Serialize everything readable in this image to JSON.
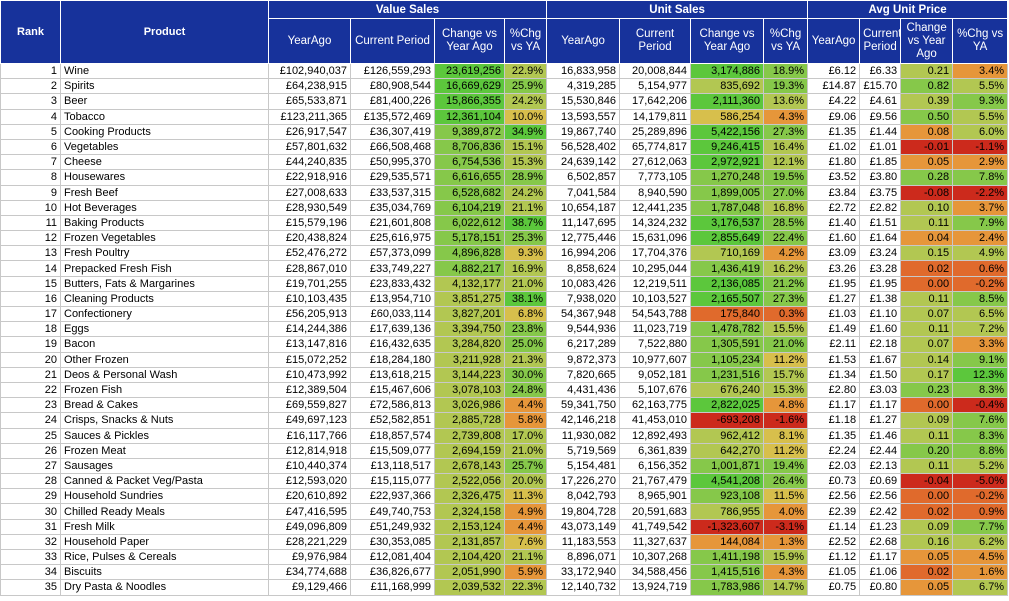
{
  "headers": {
    "rank": "Rank",
    "product": "Product",
    "groups": [
      "Value Sales",
      "Unit Sales",
      "Avg Unit Price"
    ],
    "sub": [
      "YearAgo",
      "Current Period",
      "Change vs Year Ago",
      "%Chg vs YA",
      "YearAgo",
      "Current Period",
      "Change vs Year Ago",
      "%Chg vs YA",
      "YearAgo",
      "Current Period",
      "Change vs Year Ago",
      "%Chg vs YA"
    ]
  },
  "colors": {
    "header": "#17329b",
    "strong_green": "#5cc73c",
    "green": "#86c84a",
    "yellow_green": "#b2c752",
    "yellow": "#d7bf4c",
    "orange": "#e6963a",
    "orange_red": "#e06a2c",
    "red": "#cc2a1c"
  },
  "rows": [
    [
      "1",
      "Wine",
      "£102,940,037",
      "£126,559,293",
      "23,619,256",
      "22.9%",
      "16,833,958",
      "20,008,844",
      "3,174,886",
      "18.9%",
      "£6.12",
      "£6.33",
      "0.21",
      "3.4%"
    ],
    [
      "2",
      "Spirits",
      "£64,238,915",
      "£80,908,544",
      "16,669,629",
      "25.9%",
      "4,319,285",
      "5,154,977",
      "835,692",
      "19.3%",
      "£14.87",
      "£15.70",
      "0.82",
      "5.5%"
    ],
    [
      "3",
      "Beer",
      "£65,533,871",
      "£81,400,226",
      "15,866,355",
      "24.2%",
      "15,530,846",
      "17,642,206",
      "2,111,360",
      "13.6%",
      "£4.22",
      "£4.61",
      "0.39",
      "9.3%"
    ],
    [
      "4",
      "Tobacco",
      "£123,211,365",
      "£135,572,469",
      "12,361,104",
      "10.0%",
      "13,593,557",
      "14,179,811",
      "586,254",
      "4.3%",
      "£9.06",
      "£9.56",
      "0.50",
      "5.5%"
    ],
    [
      "5",
      "Cooking Products",
      "£26,917,547",
      "£36,307,419",
      "9,389,872",
      "34.9%",
      "19,867,740",
      "25,289,896",
      "5,422,156",
      "27.3%",
      "£1.35",
      "£1.44",
      "0.08",
      "6.0%"
    ],
    [
      "6",
      "Vegetables",
      "£57,801,632",
      "£66,508,468",
      "8,706,836",
      "15.1%",
      "56,528,402",
      "65,774,817",
      "9,246,415",
      "16.4%",
      "£1.02",
      "£1.01",
      "-0.01",
      "-1.1%"
    ],
    [
      "7",
      "Cheese",
      "£44,240,835",
      "£50,995,370",
      "6,754,536",
      "15.3%",
      "24,639,142",
      "27,612,063",
      "2,972,921",
      "12.1%",
      "£1.80",
      "£1.85",
      "0.05",
      "2.9%"
    ],
    [
      "8",
      "Housewares",
      "£22,918,916",
      "£29,535,571",
      "6,616,655",
      "28.9%",
      "6,502,857",
      "7,773,105",
      "1,270,248",
      "19.5%",
      "£3.52",
      "£3.80",
      "0.28",
      "7.8%"
    ],
    [
      "9",
      "Fresh Beef",
      "£27,008,633",
      "£33,537,315",
      "6,528,682",
      "24.2%",
      "7,041,584",
      "8,940,590",
      "1,899,005",
      "27.0%",
      "£3.84",
      "£3.75",
      "-0.08",
      "-2.2%"
    ],
    [
      "10",
      "Hot Beverages",
      "£28,930,549",
      "£35,034,769",
      "6,104,219",
      "21.1%",
      "10,654,187",
      "12,441,235",
      "1,787,048",
      "16.8%",
      "£2.72",
      "£2.82",
      "0.10",
      "3.7%"
    ],
    [
      "11",
      "Baking Products",
      "£15,579,196",
      "£21,601,808",
      "6,022,612",
      "38.7%",
      "11,147,695",
      "14,324,232",
      "3,176,537",
      "28.5%",
      "£1.40",
      "£1.51",
      "0.11",
      "7.9%"
    ],
    [
      "12",
      "Frozen Vegetables",
      "£20,438,824",
      "£25,616,975",
      "5,178,151",
      "25.3%",
      "12,775,446",
      "15,631,096",
      "2,855,649",
      "22.4%",
      "£1.60",
      "£1.64",
      "0.04",
      "2.4%"
    ],
    [
      "13",
      "Fresh Poultry",
      "£52,476,272",
      "£57,373,099",
      "4,896,828",
      "9.3%",
      "16,994,206",
      "17,704,376",
      "710,169",
      "4.2%",
      "£3.09",
      "£3.24",
      "0.15",
      "4.9%"
    ],
    [
      "14",
      "Prepacked Fresh Fish",
      "£28,867,010",
      "£33,749,227",
      "4,882,217",
      "16.9%",
      "8,858,624",
      "10,295,044",
      "1,436,419",
      "16.2%",
      "£3.26",
      "£3.28",
      "0.02",
      "0.6%"
    ],
    [
      "15",
      "Butters, Fats & Margarines",
      "£19,701,255",
      "£23,833,432",
      "4,132,177",
      "21.0%",
      "10,083,426",
      "12,219,511",
      "2,136,085",
      "21.2%",
      "£1.95",
      "£1.95",
      "0.00",
      "-0.2%"
    ],
    [
      "16",
      "Cleaning Products",
      "£10,103,435",
      "£13,954,710",
      "3,851,275",
      "38.1%",
      "7,938,020",
      "10,103,527",
      "2,165,507",
      "27.3%",
      "£1.27",
      "£1.38",
      "0.11",
      "8.5%"
    ],
    [
      "17",
      "Confectionery",
      "£56,205,913",
      "£60,033,114",
      "3,827,201",
      "6.8%",
      "54,367,948",
      "54,543,788",
      "175,840",
      "0.3%",
      "£1.03",
      "£1.10",
      "0.07",
      "6.5%"
    ],
    [
      "18",
      "Eggs",
      "£14,244,386",
      "£17,639,136",
      "3,394,750",
      "23.8%",
      "9,544,936",
      "11,023,719",
      "1,478,782",
      "15.5%",
      "£1.49",
      "£1.60",
      "0.11",
      "7.2%"
    ],
    [
      "19",
      "Bacon",
      "£13,147,816",
      "£16,432,635",
      "3,284,820",
      "25.0%",
      "6,217,289",
      "7,522,880",
      "1,305,591",
      "21.0%",
      "£2.11",
      "£2.18",
      "0.07",
      "3.3%"
    ],
    [
      "20",
      "Other Frozen",
      "£15,072,252",
      "£18,284,180",
      "3,211,928",
      "21.3%",
      "9,872,373",
      "10,977,607",
      "1,105,234",
      "11.2%",
      "£1.53",
      "£1.67",
      "0.14",
      "9.1%"
    ],
    [
      "21",
      "Deos & Personal Wash",
      "£10,473,992",
      "£13,618,215",
      "3,144,223",
      "30.0%",
      "7,820,665",
      "9,052,181",
      "1,231,516",
      "15.7%",
      "£1.34",
      "£1.50",
      "0.17",
      "12.3%"
    ],
    [
      "22",
      "Frozen Fish",
      "£12,389,504",
      "£15,467,606",
      "3,078,103",
      "24.8%",
      "4,431,436",
      "5,107,676",
      "676,240",
      "15.3%",
      "£2.80",
      "£3.03",
      "0.23",
      "8.3%"
    ],
    [
      "23",
      "Bread & Cakes",
      "£69,559,827",
      "£72,586,813",
      "3,026,986",
      "4.4%",
      "59,341,750",
      "62,163,775",
      "2,822,025",
      "4.8%",
      "£1.17",
      "£1.17",
      "0.00",
      "-0.4%"
    ],
    [
      "24",
      "Crisps, Snacks & Nuts",
      "£49,697,123",
      "£52,582,851",
      "2,885,728",
      "5.8%",
      "42,146,218",
      "41,453,010",
      "-693,208",
      "-1.6%",
      "£1.18",
      "£1.27",
      "0.09",
      "7.6%"
    ],
    [
      "25",
      "Sauces & Pickles",
      "£16,117,766",
      "£18,857,574",
      "2,739,808",
      "17.0%",
      "11,930,082",
      "12,892,493",
      "962,412",
      "8.1%",
      "£1.35",
      "£1.46",
      "0.11",
      "8.3%"
    ],
    [
      "26",
      "Frozen Meat",
      "£12,814,918",
      "£15,509,077",
      "2,694,159",
      "21.0%",
      "5,719,569",
      "6,361,839",
      "642,270",
      "11.2%",
      "£2.24",
      "£2.44",
      "0.20",
      "8.8%"
    ],
    [
      "27",
      "Sausages",
      "£10,440,374",
      "£13,118,517",
      "2,678,143",
      "25.7%",
      "5,154,481",
      "6,156,352",
      "1,001,871",
      "19.4%",
      "£2.03",
      "£2.13",
      "0.11",
      "5.2%"
    ],
    [
      "28",
      "Canned & Packet Veg/Pasta",
      "£12,593,020",
      "£15,115,077",
      "2,522,056",
      "20.0%",
      "17,226,270",
      "21,767,479",
      "4,541,208",
      "26.4%",
      "£0.73",
      "£0.69",
      "-0.04",
      "-5.0%"
    ],
    [
      "29",
      "Household Sundries",
      "£20,610,892",
      "£22,937,366",
      "2,326,475",
      "11.3%",
      "8,042,793",
      "8,965,901",
      "923,108",
      "11.5%",
      "£2.56",
      "£2.56",
      "0.00",
      "-0.2%"
    ],
    [
      "30",
      "Chilled Ready Meals",
      "£47,416,595",
      "£49,740,753",
      "2,324,158",
      "4.9%",
      "19,804,728",
      "20,591,683",
      "786,955",
      "4.0%",
      "£2.39",
      "£2.42",
      "0.02",
      "0.9%"
    ],
    [
      "31",
      "Fresh Milk",
      "£49,096,809",
      "£51,249,932",
      "2,153,124",
      "4.4%",
      "43,073,149",
      "41,749,542",
      "-1,323,607",
      "-3.1%",
      "£1.14",
      "£1.23",
      "0.09",
      "7.7%"
    ],
    [
      "32",
      "Household Paper",
      "£28,221,229",
      "£30,353,085",
      "2,131,857",
      "7.6%",
      "11,183,553",
      "11,327,637",
      "144,084",
      "1.3%",
      "£2.52",
      "£2.68",
      "0.16",
      "6.2%"
    ],
    [
      "33",
      "Rice, Pulses & Cereals",
      "£9,976,984",
      "£12,081,404",
      "2,104,420",
      "21.1%",
      "8,896,071",
      "10,307,268",
      "1,411,198",
      "15.9%",
      "£1.12",
      "£1.17",
      "0.05",
      "4.5%"
    ],
    [
      "34",
      "Biscuits",
      "£34,774,688",
      "£36,826,677",
      "2,051,990",
      "5.9%",
      "33,172,940",
      "34,588,456",
      "1,415,516",
      "4.3%",
      "£1.05",
      "£1.06",
      "0.02",
      "1.6%"
    ],
    [
      "35",
      "Dry Pasta & Noodles",
      "£9,129,466",
      "£11,168,999",
      "2,039,532",
      "22.3%",
      "12,140,732",
      "13,924,719",
      "1,783,986",
      "14.7%",
      "£0.75",
      "£0.80",
      "0.05",
      "6.7%"
    ]
  ],
  "cell_colors": [
    [
      "strong_green",
      "yellow_green",
      "strong_green",
      "green",
      "yellow_green",
      "orange"
    ],
    [
      "strong_green",
      "green",
      "yellow_green",
      "green",
      "green",
      "yellow_green"
    ],
    [
      "strong_green",
      "yellow_green",
      "strong_green",
      "yellow_green",
      "yellow_green",
      "green"
    ],
    [
      "strong_green",
      "yellow",
      "yellow",
      "orange",
      "green",
      "yellow_green"
    ],
    [
      "green",
      "strong_green",
      "strong_green",
      "green",
      "orange",
      "yellow_green"
    ],
    [
      "green",
      "yellow_green",
      "strong_green",
      "yellow_green",
      "red",
      "red"
    ],
    [
      "green",
      "yellow_green",
      "strong_green",
      "yellow_green",
      "orange",
      "orange"
    ],
    [
      "green",
      "green",
      "green",
      "green",
      "green",
      "green"
    ],
    [
      "green",
      "yellow_green",
      "green",
      "green",
      "red",
      "red"
    ],
    [
      "green",
      "yellow_green",
      "green",
      "yellow_green",
      "yellow_green",
      "orange"
    ],
    [
      "green",
      "strong_green",
      "strong_green",
      "green",
      "yellow_green",
      "green"
    ],
    [
      "green",
      "green",
      "strong_green",
      "green",
      "orange",
      "orange"
    ],
    [
      "green",
      "yellow",
      "yellow_green",
      "orange",
      "yellow_green",
      "yellow_green"
    ],
    [
      "green",
      "yellow_green",
      "green",
      "yellow_green",
      "orange_red",
      "orange_red"
    ],
    [
      "yellow_green",
      "yellow_green",
      "strong_green",
      "green",
      "orange_red",
      "orange_red"
    ],
    [
      "yellow_green",
      "strong_green",
      "strong_green",
      "green",
      "yellow_green",
      "green"
    ],
    [
      "yellow_green",
      "yellow",
      "orange_red",
      "orange_red",
      "yellow_green",
      "yellow_green"
    ],
    [
      "yellow_green",
      "green",
      "green",
      "yellow_green",
      "yellow_green",
      "yellow_green"
    ],
    [
      "yellow_green",
      "green",
      "green",
      "green",
      "yellow_green",
      "orange"
    ],
    [
      "yellow_green",
      "yellow_green",
      "green",
      "yellow",
      "yellow_green",
      "green"
    ],
    [
      "yellow_green",
      "green",
      "green",
      "yellow_green",
      "yellow_green",
      "strong_green"
    ],
    [
      "yellow_green",
      "green",
      "yellow_green",
      "yellow_green",
      "green",
      "green"
    ],
    [
      "yellow_green",
      "orange",
      "strong_green",
      "orange",
      "orange_red",
      "red"
    ],
    [
      "yellow_green",
      "orange",
      "red",
      "red",
      "yellow_green",
      "green"
    ],
    [
      "yellow_green",
      "yellow_green",
      "yellow_green",
      "yellow",
      "yellow_green",
      "green"
    ],
    [
      "yellow_green",
      "yellow_green",
      "yellow_green",
      "yellow",
      "green",
      "green"
    ],
    [
      "yellow_green",
      "green",
      "green",
      "green",
      "yellow_green",
      "yellow_green"
    ],
    [
      "yellow_green",
      "yellow_green",
      "strong_green",
      "green",
      "red",
      "red"
    ],
    [
      "yellow_green",
      "yellow",
      "green",
      "yellow",
      "orange_red",
      "orange_red"
    ],
    [
      "yellow_green",
      "orange",
      "yellow_green",
      "orange",
      "orange_red",
      "orange_red"
    ],
    [
      "yellow_green",
      "orange",
      "red",
      "red",
      "yellow_green",
      "green"
    ],
    [
      "yellow_green",
      "yellow",
      "orange",
      "orange",
      "yellow_green",
      "yellow_green"
    ],
    [
      "yellow_green",
      "yellow_green",
      "green",
      "yellow_green",
      "orange",
      "orange"
    ],
    [
      "yellow_green",
      "orange",
      "green",
      "orange",
      "orange_red",
      "orange"
    ],
    [
      "yellow_green",
      "yellow_green",
      "green",
      "yellow_green",
      "orange",
      "yellow_green"
    ]
  ]
}
